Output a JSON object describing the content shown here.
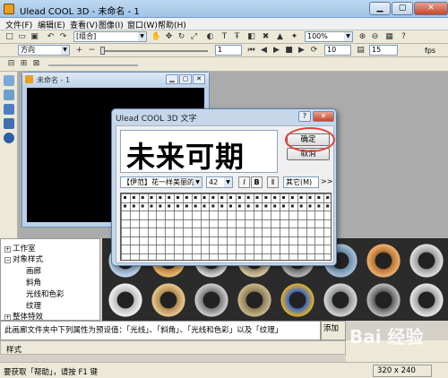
{
  "app": {
    "title": "Ulead COOL 3D - 未命名 - 1"
  },
  "menubar": {
    "items": [
      "文件(F)",
      "编辑(E)",
      "查看(V)",
      "图像(I)",
      "窗口(W)",
      "帮助(H)"
    ]
  },
  "toolbar": {
    "group_combo": "[组合]",
    "zoom_combo": "100%",
    "direction_combo": "方向",
    "frame_value": "1",
    "frames_total": "10",
    "fps_value": "15",
    "fps_label": "fps"
  },
  "doc_window": {
    "title": "未命名 - 1"
  },
  "dialog": {
    "title": "Ulead COOL 3D 文字",
    "help_button": "?",
    "preview_text": "未来可期",
    "ok_button": "确定",
    "cancel_button": "取消",
    "font_select": "【伊范】花一样美丽的",
    "size_select": "42",
    "italic_label": "I",
    "bold_label": "B",
    "other_button": "其它(M)",
    "more_button": ">>"
  },
  "tree": {
    "items": [
      {
        "label": "工作室",
        "level": 0,
        "box": "+"
      },
      {
        "label": "对象样式",
        "level": 0,
        "box": "−"
      },
      {
        "label": "画廊",
        "level": 1
      },
      {
        "label": "斜角",
        "level": 1
      },
      {
        "label": "光线和色彩",
        "level": 1
      },
      {
        "label": "纹理",
        "level": 1
      },
      {
        "label": "整体特效",
        "level": 0,
        "box": "+"
      }
    ]
  },
  "description": {
    "text": "此画廊文件夹中下列属性为预设值：「光线」、「斜角」、「光线和色彩」以及「纹理」"
  },
  "add_label": "添加",
  "style_label": "样式",
  "status": {
    "text": "要获取「帮助」，请按 F1 键",
    "resolution": "320 x 240"
  },
  "watermark": "Bai 经验",
  "colors": {
    "dialog_border": "#5f7fa6",
    "highlight_circle": "#e0403a",
    "thumb_bg": "#2b2b2b"
  }
}
